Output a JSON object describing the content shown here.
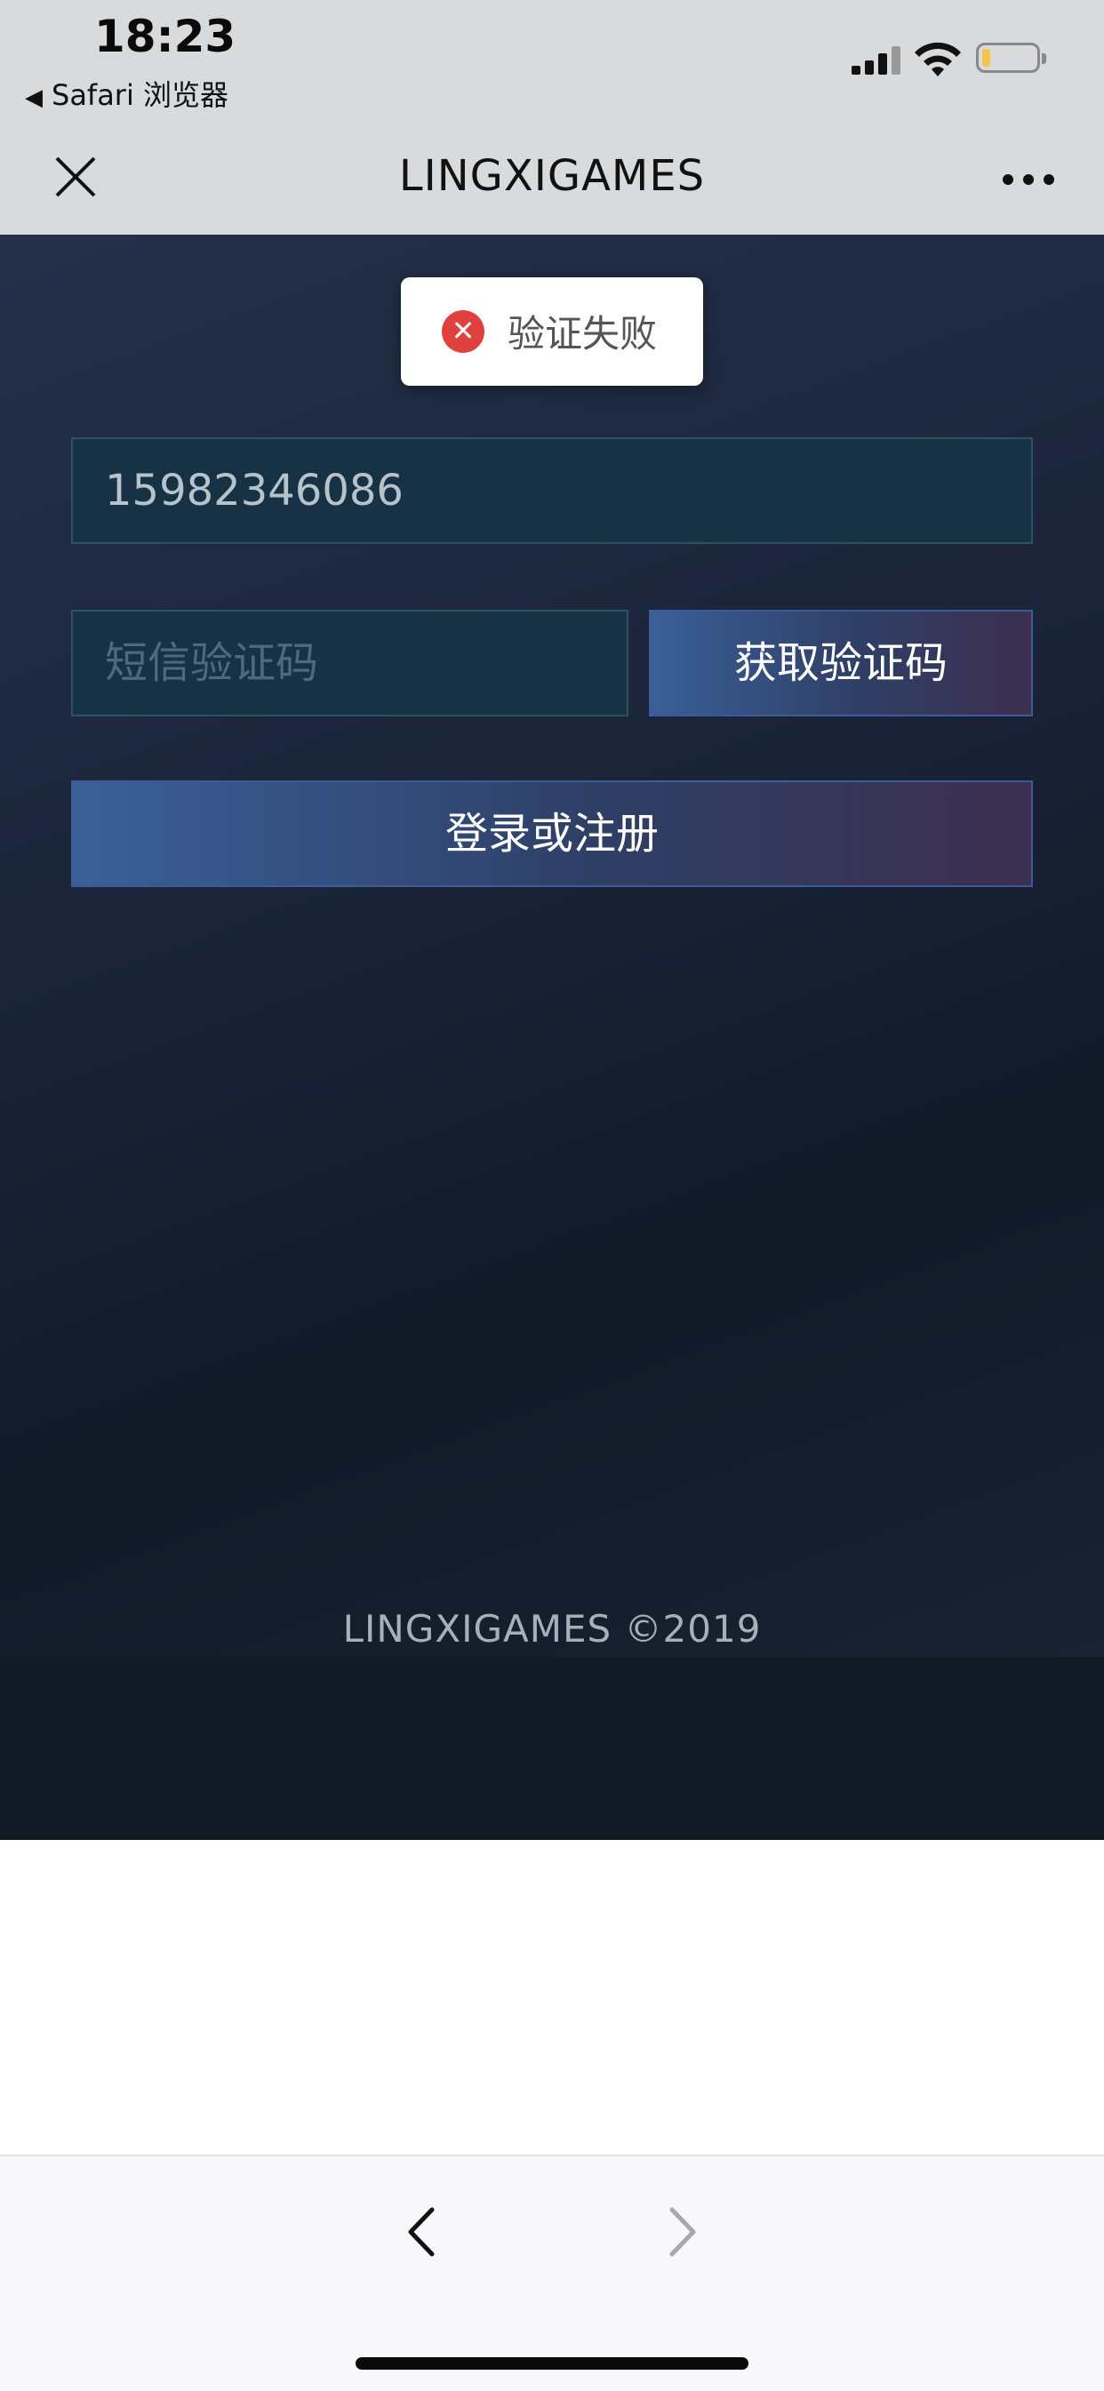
{
  "status_bar": {
    "time": "18:23",
    "back_app_label": "Safari 浏览器",
    "battery_level": 0.15,
    "battery_color": "#f2c54b"
  },
  "nav": {
    "title": "LINGXIGAMES",
    "close_icon": "close-icon",
    "more_icon": "more-icon"
  },
  "toast": {
    "message": "验证失败",
    "icon": "error-icon",
    "icon_color": "#e0413f"
  },
  "form": {
    "phone_value": "15982346086",
    "sms_placeholder": "短信验证码",
    "get_code_label": "获取验证码",
    "login_label": "登录或注册"
  },
  "footer": {
    "copyright": "LINGXIGAMES ©2019"
  },
  "toolbar": {
    "back_icon": "chevron-left-icon",
    "forward_icon": "chevron-right-icon"
  }
}
